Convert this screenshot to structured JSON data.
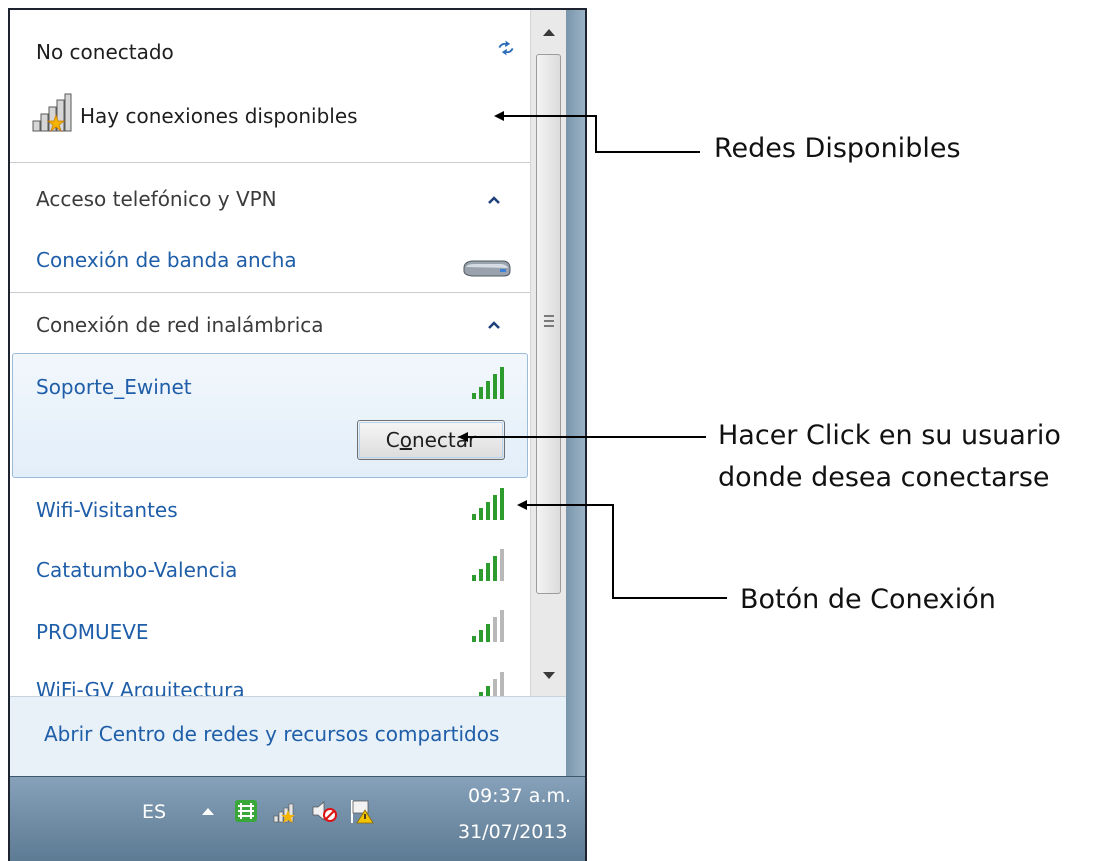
{
  "flyout": {
    "status_title": "No conectado",
    "availability_text": "Hay conexiones disponibles",
    "sections": [
      {
        "title": "Acceso telefónico y VPN",
        "items": [
          {
            "name": "Conexión de banda ancha"
          }
        ]
      },
      {
        "title": "Conexión de red inalámbrica"
      }
    ],
    "wireless_networks": [
      {
        "name": "Soporte_Ewinet",
        "signal_bars": 5,
        "selected": true
      },
      {
        "name": "Wifi-Visitantes",
        "signal_bars": 5
      },
      {
        "name": "Catatumbo-Valencia",
        "signal_bars": 4
      },
      {
        "name": "PROMUEVE",
        "signal_bars": 3
      },
      {
        "name": "WiFi-GV Arquitectura",
        "signal_bars": 3
      }
    ],
    "connect_button": {
      "label_pre": "C",
      "label_accel": "o",
      "label_post": "nectar"
    },
    "footer_link": "Abrir Centro de redes y recursos compartidos"
  },
  "taskbar": {
    "language": "ES",
    "time": "09:37 a.m.",
    "date": "31/07/2013",
    "tray_icons": [
      "network-status-icon",
      "wireless-warning-icon",
      "volume-muted-icon",
      "action-center-flag-icon"
    ]
  },
  "annotations": {
    "redes": "Redes Disponibles",
    "click_line1": "Hacer Click en su usuario",
    "click_line2": "donde desea conectarse",
    "boton": "Botón de Conexión"
  },
  "colors": {
    "link_blue": "#1f5ea8",
    "signal_green": "#2e9b2e",
    "signal_gray": "#b8b8b8",
    "selection_border": "#9cbbd9",
    "taskbar": "#6f8ca5"
  }
}
